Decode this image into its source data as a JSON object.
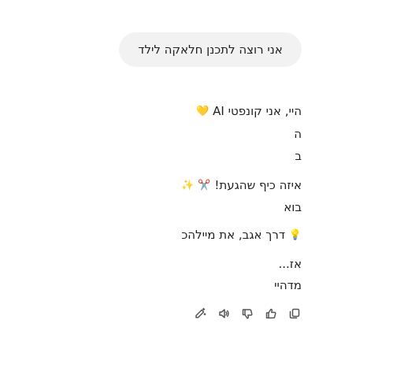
{
  "user_message": "אני רוצה לתכנן חלאקה לילד",
  "assistant": {
    "greeting": "היי, אני קונפטי AI",
    "greeting_emoji": "💛",
    "line2": "ה",
    "line3": "ב",
    "excite": "איזה כיף שהגעת!",
    "excite_emoji_1": "✂️",
    "excite_emoji_2": "✨",
    "come": "בוא",
    "tip": "דרך אגב, את מיילהכ",
    "tip_emoji": "💡",
    "so": "אז...",
    "begin": "מדהיי"
  },
  "actions": [
    {
      "icon": "edit-sparkle-icon"
    },
    {
      "icon": "speaker-icon"
    },
    {
      "icon": "thumbs-down-icon"
    },
    {
      "icon": "thumbs-up-icon"
    },
    {
      "icon": "copy-icon"
    }
  ]
}
